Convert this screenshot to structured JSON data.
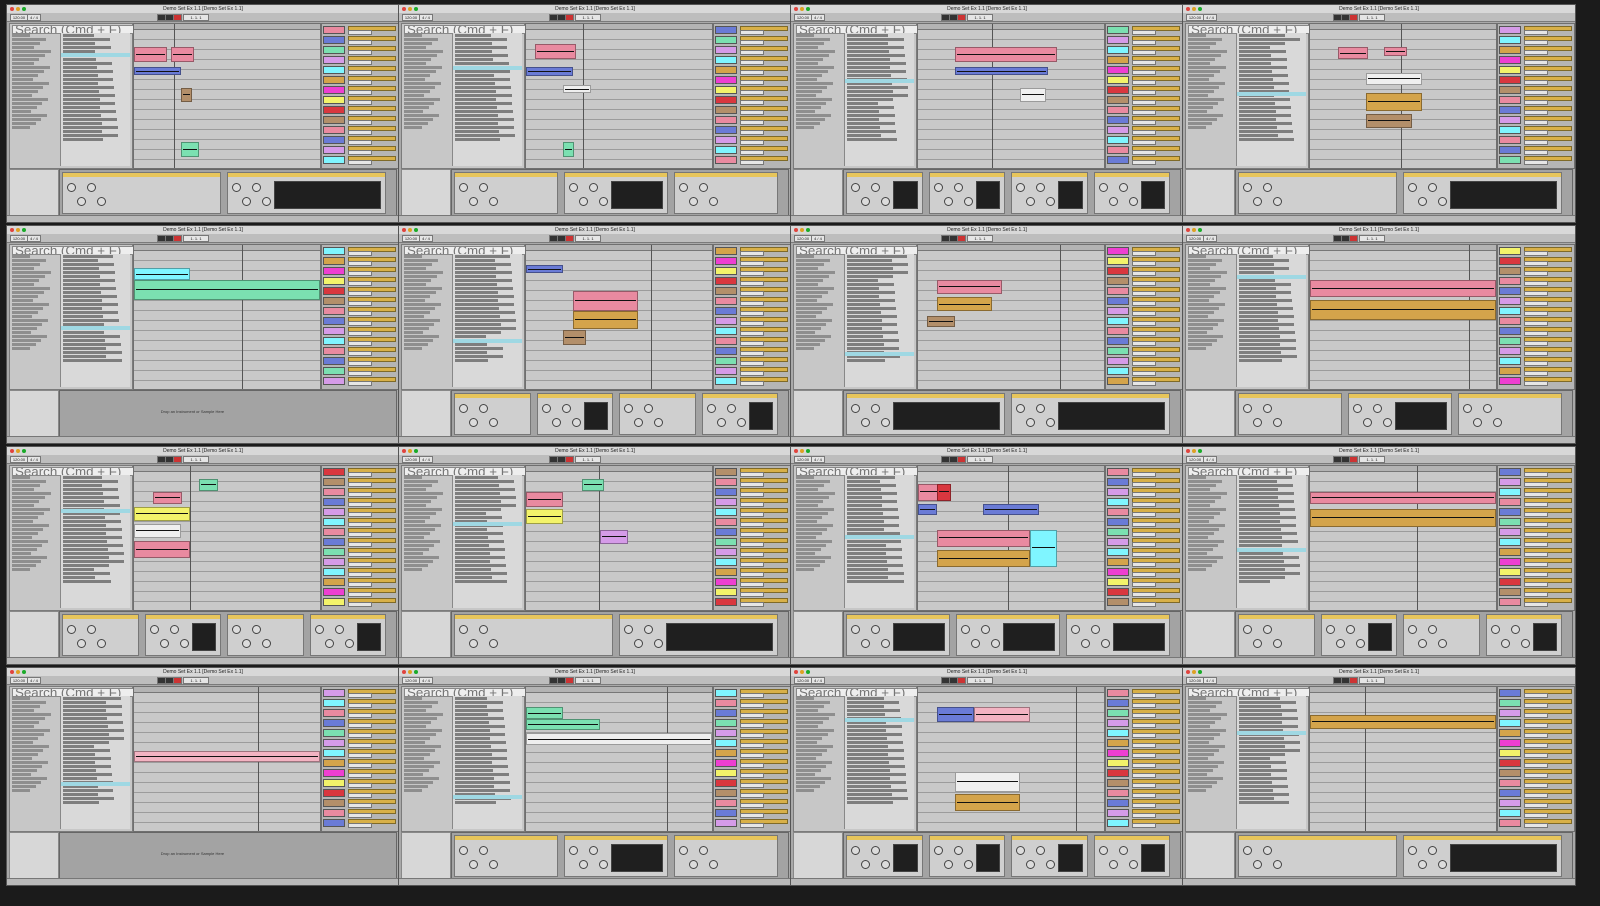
{
  "screen": {
    "window_title": "Demo Set Ex 1.1 [Demo Set Ex 1.1]",
    "transport": {
      "tempo": "120.00",
      "time_signature": "4 / 4",
      "position": "1. 1. 1"
    },
    "browser": {
      "search_placeholder": "Search (Cmd + F)"
    },
    "drop_hint": "Drop an Instrument or Sample Here",
    "colors": {
      "pink": "#e98aa0",
      "red": "#d9373f",
      "blue": "#6a7bd6",
      "green": "#7be0b1",
      "cyan": "#7ff5ff",
      "violet": "#d59be8",
      "magenta": "#ee3fd1",
      "gold": "#d4a44b",
      "yellow": "#f3f36a",
      "brown": "#b38f6a",
      "lightpink": "#f3b3c2",
      "white": "#efefef"
    }
  }
}
